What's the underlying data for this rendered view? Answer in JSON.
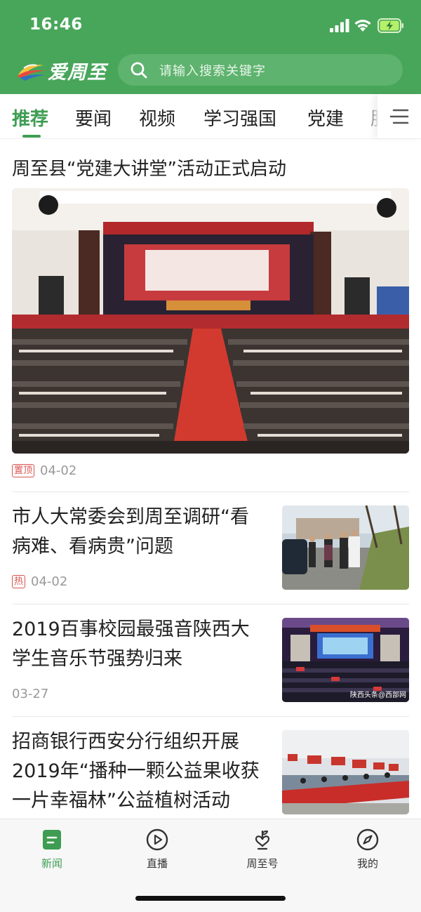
{
  "status_bar": {
    "time": "16:46"
  },
  "header": {
    "logo_text": "爱周至",
    "search_placeholder": "请输入搜索关键字"
  },
  "tabs": [
    {
      "label": "推荐",
      "active": true
    },
    {
      "label": "要闻",
      "active": false
    },
    {
      "label": "视频",
      "active": false
    },
    {
      "label": "学习强国",
      "active": false
    },
    {
      "label": "党建",
      "active": false
    },
    {
      "label": "服",
      "active": false
    }
  ],
  "lead": {
    "title": "周至县“党建大讲堂”活动正式启动",
    "tag": "置顶",
    "date": "04-02",
    "image_desc": "conference hall with audience and red carpet"
  },
  "news_items": [
    {
      "title_lines": [
        "市人大常委会到周至调研“看",
        "病难、看病贵”问题"
      ],
      "tag": "热",
      "date": "04-02"
    },
    {
      "title_lines": [
        "2019百事校园最强音陕西大",
        "学生音乐节强势归来"
      ],
      "tag": "",
      "date": "03-27",
      "image_watermark": "陕西头条@西部网"
    },
    {
      "title_lines": [
        "招商银行西安分行组织开展",
        "2019年“播种一颗公益果收获",
        "一片幸福林”公益植树活动"
      ],
      "tag": "",
      "date": ""
    }
  ],
  "bottom_nav": [
    {
      "label": "新闻",
      "icon": "news-icon",
      "active": true
    },
    {
      "label": "直播",
      "icon": "play-icon",
      "active": false
    },
    {
      "label": "周至号",
      "icon": "heart-plant-icon",
      "active": false
    },
    {
      "label": "我的",
      "icon": "compass-icon",
      "active": false
    }
  ],
  "colors": {
    "brand_green": "#48a65a",
    "active_green": "#3e9d52",
    "tag_red": "#d9534f"
  }
}
